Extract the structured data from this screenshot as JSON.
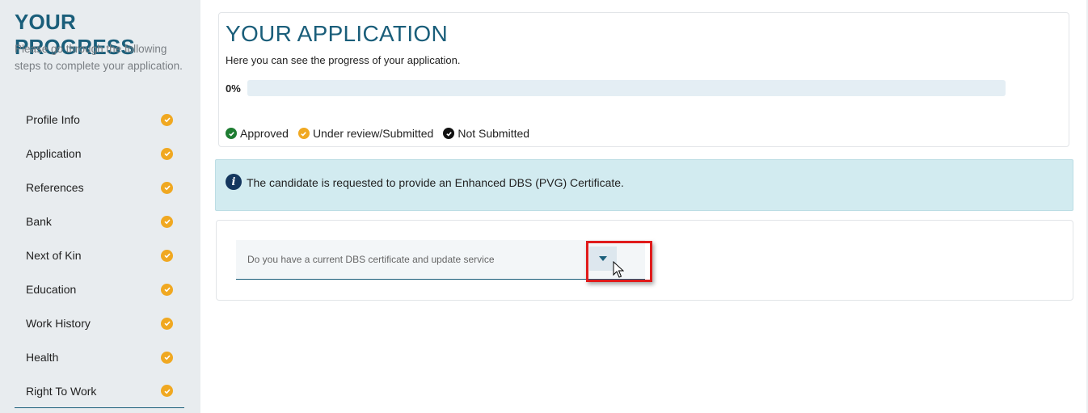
{
  "sidebar": {
    "title": "YOUR PROGRESS",
    "intro": "Please go through the following steps to complete your application.",
    "steps": [
      {
        "label": "Profile Info",
        "status": "under-review"
      },
      {
        "label": "Application",
        "status": "under-review"
      },
      {
        "label": "References",
        "status": "under-review"
      },
      {
        "label": "Bank",
        "status": "under-review"
      },
      {
        "label": "Next of Kin",
        "status": "under-review"
      },
      {
        "label": "Education",
        "status": "under-review"
      },
      {
        "label": "Work History",
        "status": "under-review"
      },
      {
        "label": "Health",
        "status": "under-review"
      },
      {
        "label": "Right To Work",
        "status": "under-review"
      }
    ]
  },
  "application": {
    "title": "YOUR APPLICATION",
    "subtitle": "Here you can see the progress of your application.",
    "progress_label": "0%",
    "progress_fraction": 0,
    "legend": {
      "approved": "Approved",
      "under_review": "Under review/Submitted",
      "not_submitted": "Not Submitted"
    }
  },
  "alert": {
    "message": "The candidate is requested to provide an Enhanced DBS (PVG) Certificate."
  },
  "form": {
    "dbs_select_placeholder": "Do you have a current DBS certificate and update service"
  },
  "colors": {
    "accent": "#1a5e7a",
    "under_review": "#f0a821",
    "approved": "#1e7d32",
    "not_submitted": "#111111",
    "alert_bg": "#d2ebf0",
    "highlight": "#e01b1b"
  },
  "icons": {
    "step_status": "check-circle-icon",
    "alert": "info-icon",
    "dropdown": "caret-down-icon"
  }
}
